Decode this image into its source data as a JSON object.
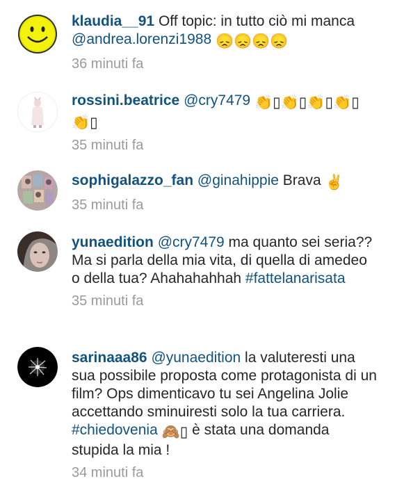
{
  "comments": [
    {
      "username": "klaudia__91",
      "text": "Off topic: in tutto ciò mi manca ",
      "mention": "@andrea.lorenzi1988",
      "emoji": "😞😞😞😞",
      "time": "36 minuti fa"
    },
    {
      "username": "rossini.beatrice",
      "mention": "@cry7479",
      "emoji_line1": "👏▯👏▯👏▯👏▯",
      "emoji_line2": "👏▯",
      "time": "35 minuti fa"
    },
    {
      "username": "sophigalazzo_fan",
      "mention": "@ginahippie",
      "text": " Brava ",
      "emoji": "✌️",
      "time": "35 minuti fa"
    },
    {
      "username": "yunaedition",
      "mention": "@cry7479",
      "text": " ma quanto sei seria?? Ma si parla della mia vita, di quella di amedeo o della tua? Ahahahahhah ",
      "hashtag": "#fattelanarisata",
      "time": "35 minuti fa"
    },
    {
      "username": "sarinaaa86",
      "mention": "@yunaedition",
      "text_before": " la valuteresti una sua possibile proposta come protagonista di un film? Ops dimenticavo tu sei Angelina Jolie accettando sminuiresti solo la tua carriera. ",
      "hashtag": "#chiedovenia",
      "emoji": "🙈▯",
      "text_after": " è stata una domanda stupida la mia !",
      "time": "34 minuti fa"
    }
  ],
  "colors": {
    "username": "#11527f",
    "link": "#11527f",
    "text": "#262626",
    "time": "#9a9a9a"
  }
}
